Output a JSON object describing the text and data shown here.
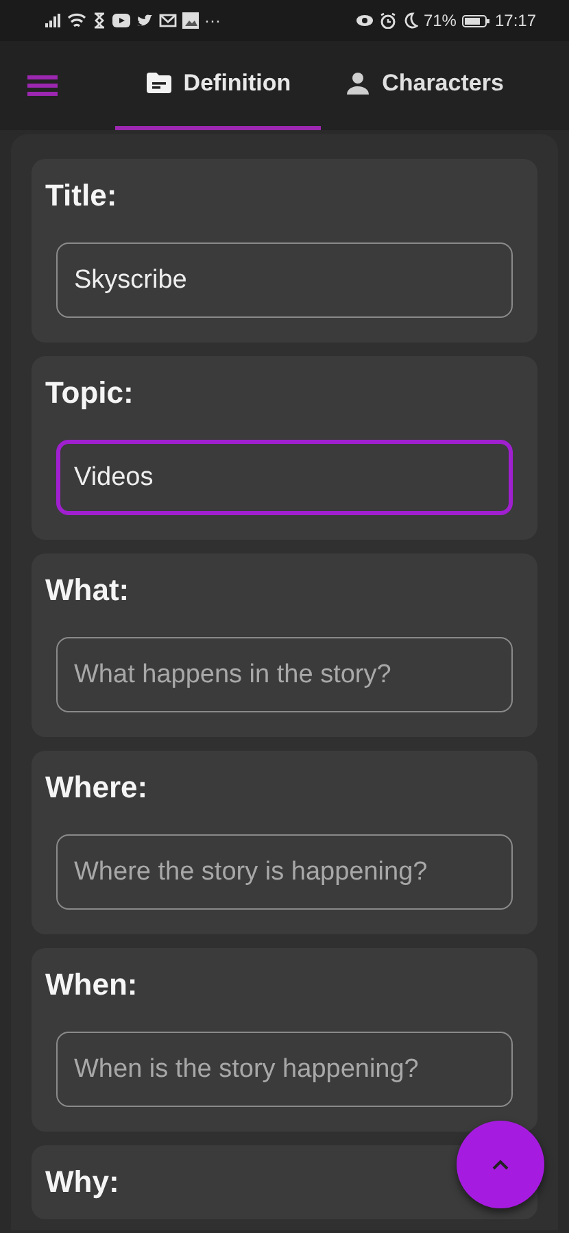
{
  "status_bar": {
    "overflow": "···",
    "battery": "71%",
    "time": "17:17"
  },
  "tabs": [
    {
      "label": "Definition",
      "selected": true
    },
    {
      "label": "Characters",
      "selected": false
    }
  ],
  "cards": [
    {
      "label": "Title:",
      "value": "Skyscribe",
      "focused": false
    },
    {
      "label": "Topic:",
      "value": "Videos",
      "focused": true
    },
    {
      "label": "What:",
      "placeholder": "What happens in the story?",
      "focused": false
    },
    {
      "label": "Where:",
      "placeholder": "Where the story is happening?",
      "focused": false
    },
    {
      "label": "When:",
      "placeholder": "When is the story happening?",
      "focused": false
    },
    {
      "label": "Why:"
    }
  ]
}
